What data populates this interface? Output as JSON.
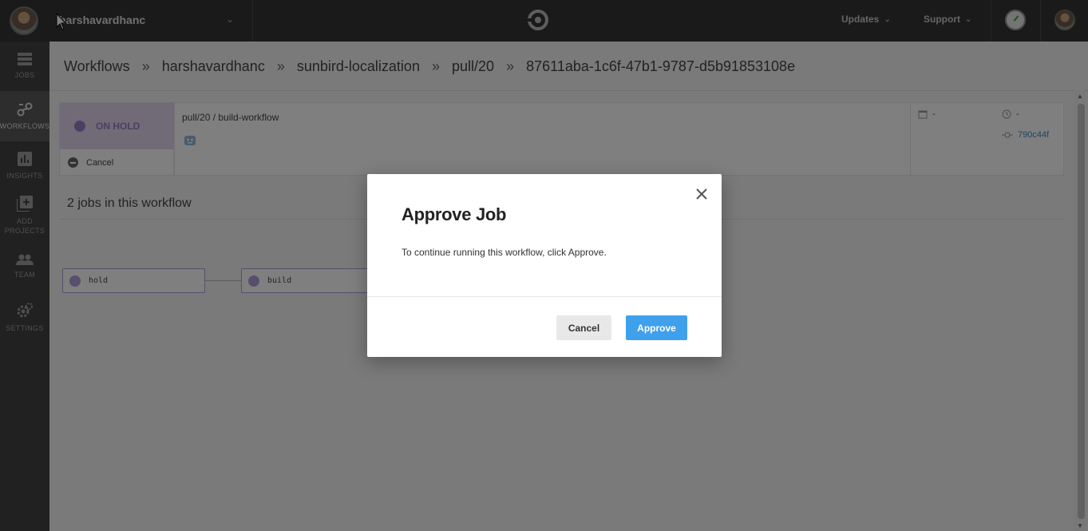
{
  "topbar": {
    "org_name": "harshavardhanc",
    "updates_label": "Updates",
    "support_label": "Support"
  },
  "sidebar": {
    "items": [
      {
        "label": "JOBS",
        "icon": "jobs-icon"
      },
      {
        "label": "WORKFLOWS",
        "icon": "workflows-icon"
      },
      {
        "label": "INSIGHTS",
        "icon": "insights-icon"
      },
      {
        "label": "ADD PROJECTS",
        "icon": "add-projects-icon"
      },
      {
        "label": "TEAM",
        "icon": "team-icon"
      },
      {
        "label": "SETTINGS",
        "icon": "settings-icon"
      }
    ]
  },
  "breadcrumb": [
    "Workflows",
    "harshavardhanc",
    "sunbird-localization",
    "pull/20",
    "87611aba-1c6f-47b1-9787-d5b91853108e"
  ],
  "breadcrumb_separator": "»",
  "workflow": {
    "status": "ON HOLD",
    "cancel_label": "Cancel",
    "title": "pull/20 / build-workflow",
    "date": "-",
    "duration": "-",
    "commit": "790c44f"
  },
  "jobs": {
    "heading": "2 jobs in this workflow",
    "nodes": [
      {
        "name": "hold"
      },
      {
        "name": "build"
      }
    ]
  },
  "modal": {
    "title": "Approve Job",
    "body": "To continue running this workflow, click Approve.",
    "cancel_label": "Cancel",
    "approve_label": "Approve"
  },
  "colors": {
    "topbar": "#343434",
    "sidebar": "#424242",
    "on_hold": "#9b7fc2",
    "approve": "#3fa0ec",
    "commit_link": "#3a8ec4"
  }
}
